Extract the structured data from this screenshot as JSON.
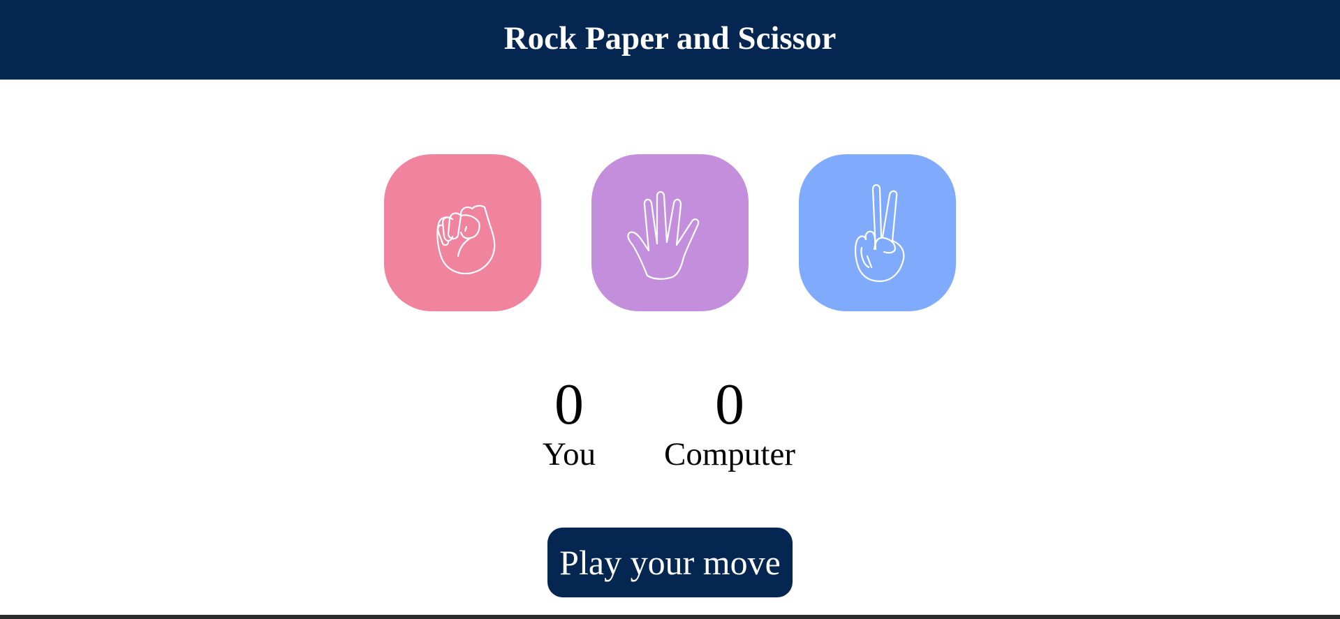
{
  "header": {
    "title": "Rock Paper and Scissor",
    "bg_color": "#042650"
  },
  "choices": [
    {
      "id": "rock",
      "icon": "rock-fist-icon",
      "color": "#f0849f"
    },
    {
      "id": "paper",
      "icon": "paper-hand-icon",
      "color": "#c38fdd"
    },
    {
      "id": "scissors",
      "icon": "scissors-hand-icon",
      "color": "#80abfd"
    }
  ],
  "score": {
    "user_score": "0",
    "user_label": "You",
    "computer_score": "0",
    "computer_label": "Computer"
  },
  "message": {
    "text": "Play your move"
  }
}
